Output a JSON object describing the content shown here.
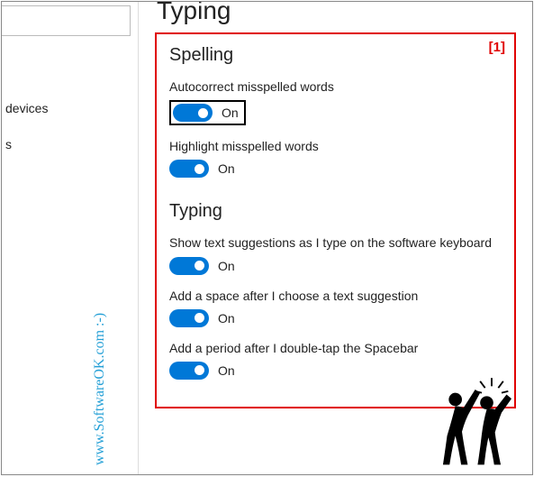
{
  "sidebar": {
    "search_placeholder": "",
    "items": [
      {
        "label": "devices"
      },
      {
        "label": "s"
      },
      {
        "label": ""
      }
    ]
  },
  "page": {
    "title": "Typing",
    "annotation": "[1]"
  },
  "sections": {
    "spelling": {
      "heading": "Spelling",
      "settings": [
        {
          "label": "Autocorrect misspelled words",
          "state": "On"
        },
        {
          "label": "Highlight misspelled words",
          "state": "On"
        }
      ]
    },
    "typing": {
      "heading": "Typing",
      "settings": [
        {
          "label": "Show text suggestions as I type on the software keyboard",
          "state": "On"
        },
        {
          "label": "Add a space after I choose a text suggestion",
          "state": "On"
        },
        {
          "label": "Add a period after I double-tap the Spacebar",
          "state": "On"
        }
      ]
    }
  },
  "watermark": "www.SoftwareOK.com :-)"
}
